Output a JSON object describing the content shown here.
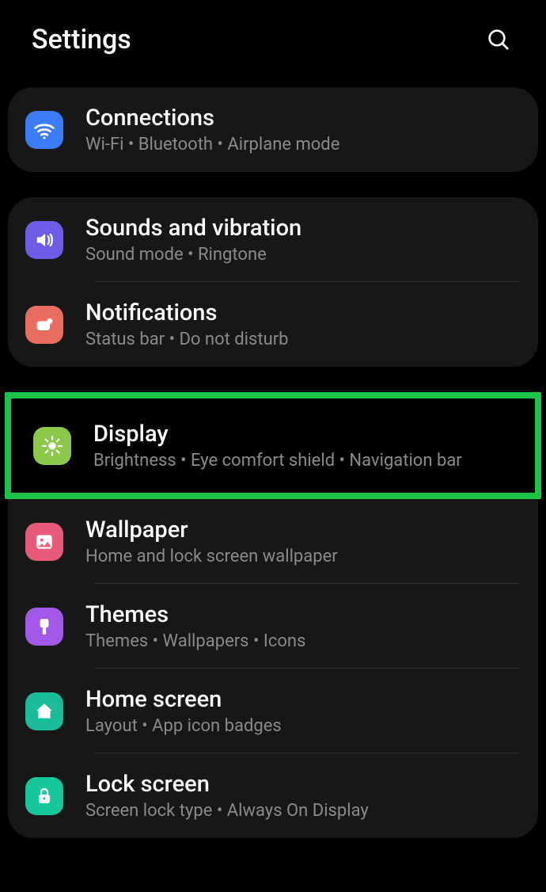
{
  "header": {
    "title": "Settings"
  },
  "groups": [
    {
      "items": [
        {
          "key": "connections",
          "title": "Connections",
          "sub": "Wi-Fi  •  Bluetooth  •  Airplane mode",
          "icon": "wifi",
          "color": "ico-blue"
        }
      ]
    },
    {
      "items": [
        {
          "key": "sounds",
          "title": "Sounds and vibration",
          "sub": "Sound mode  •  Ringtone",
          "icon": "sound",
          "color": "ico-purple"
        },
        {
          "key": "notifications",
          "title": "Notifications",
          "sub": "Status bar  •  Do not disturb",
          "icon": "notif",
          "color": "ico-coral"
        }
      ]
    },
    {
      "highlighted": 0,
      "items": [
        {
          "key": "display",
          "title": "Display",
          "sub": "Brightness  •  Eye comfort shield  •  Navigation bar",
          "icon": "brightness",
          "color": "ico-green"
        },
        {
          "key": "wallpaper",
          "title": "Wallpaper",
          "sub": "Home and lock screen wallpaper",
          "icon": "image",
          "color": "ico-pink"
        },
        {
          "key": "themes",
          "title": "Themes",
          "sub": "Themes  •  Wallpapers  •  Icons",
          "icon": "brush",
          "color": "ico-violet"
        },
        {
          "key": "home",
          "title": "Home screen",
          "sub": "Layout  •  App icon badges",
          "icon": "home",
          "color": "ico-teal"
        },
        {
          "key": "lock",
          "title": "Lock screen",
          "sub": "Screen lock type  •  Always On Display",
          "icon": "lock",
          "color": "ico-teal2"
        }
      ]
    }
  ]
}
